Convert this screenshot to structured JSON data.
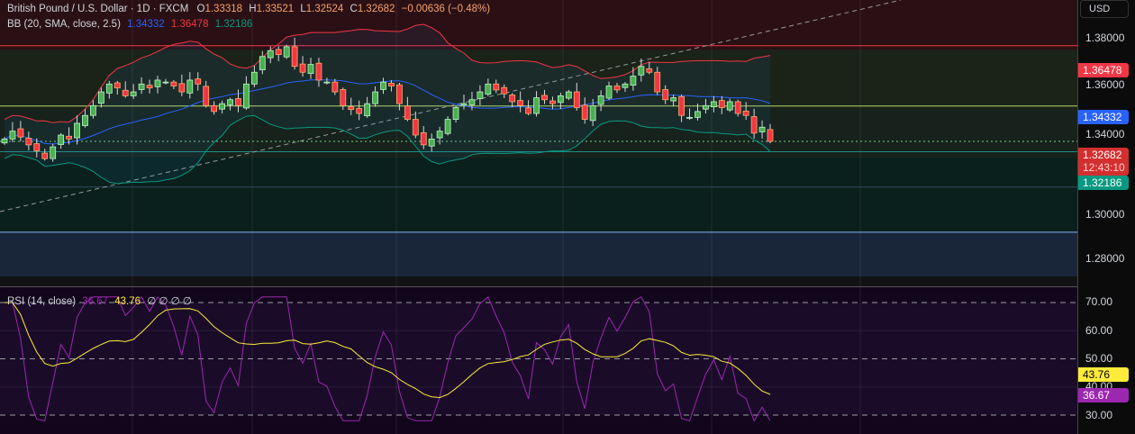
{
  "header": {
    "symbol": "British Pound / U.S. Dollar · 1D · FXCM",
    "o_label": "O",
    "o": "1.33318",
    "h_label": "H",
    "h": "1.33521",
    "l_label": "L",
    "l": "1.32524",
    "c_label": "C",
    "c": "1.32682",
    "change": "−0.00636 (−0.48%)"
  },
  "bb": {
    "label": "BB (20, SMA, close, 2.5)",
    "basis": "1.34332",
    "upper": "1.36478",
    "lower": "1.32186"
  },
  "rsi": {
    "label": "RSI (14, close)",
    "value": "36.67",
    "ma": "43.76",
    "extra": "∅ ∅ ∅ ∅"
  },
  "axis": {
    "currency": "USD",
    "price_ticks": [
      "1.38000",
      "1.36000",
      "1.34000",
      "1.30000",
      "1.28000"
    ],
    "rsi_ticks": [
      "70.00",
      "60.00",
      "50.00",
      "40.00",
      "30.00"
    ],
    "countdown": "12:43:10"
  },
  "colors": {
    "up": "#4caf50",
    "down": "#f23645",
    "basis": "#2962ff",
    "upper": "#f23645",
    "lower": "#089981",
    "rsi": "#9c27b0",
    "rsi_ma": "#ffeb3b"
  },
  "chart_data": {
    "type": "candlestick",
    "ylim": [
      1.27,
      1.395
    ],
    "rsi_ylim": [
      25,
      75
    ],
    "closes": [
      1.328,
      1.332,
      1.329,
      1.325,
      1.322,
      1.318,
      1.324,
      1.33,
      1.328,
      1.336,
      1.34,
      1.345,
      1.352,
      1.356,
      1.354,
      1.35,
      1.352,
      1.356,
      1.354,
      1.358,
      1.357,
      1.355,
      1.352,
      1.358,
      1.356,
      1.345,
      1.342,
      1.346,
      1.348,
      1.345,
      1.356,
      1.362,
      1.37,
      1.373,
      1.371,
      1.375,
      1.365,
      1.362,
      1.366,
      1.358,
      1.357,
      1.352,
      1.345,
      1.343,
      1.341,
      1.346,
      1.352,
      1.357,
      1.355,
      1.346,
      1.338,
      1.33,
      1.325,
      1.328,
      1.332,
      1.338,
      1.344,
      1.346,
      1.348,
      1.352,
      1.356,
      1.353,
      1.351,
      1.347,
      1.345,
      1.341,
      1.349,
      1.348,
      1.346,
      1.35,
      1.352,
      1.344,
      1.338,
      1.345,
      1.35,
      1.355,
      1.353,
      1.356,
      1.36,
      1.365,
      1.362,
      1.352,
      1.348,
      1.349,
      1.34,
      1.339,
      1.342,
      1.345,
      1.347,
      1.344,
      1.347,
      1.341,
      1.34,
      1.331,
      1.334,
      1.32682
    ],
    "hlines": [
      1.3755,
      1.3448,
      1.3268,
      1.3215,
      1.3035,
      1.2805
    ]
  }
}
